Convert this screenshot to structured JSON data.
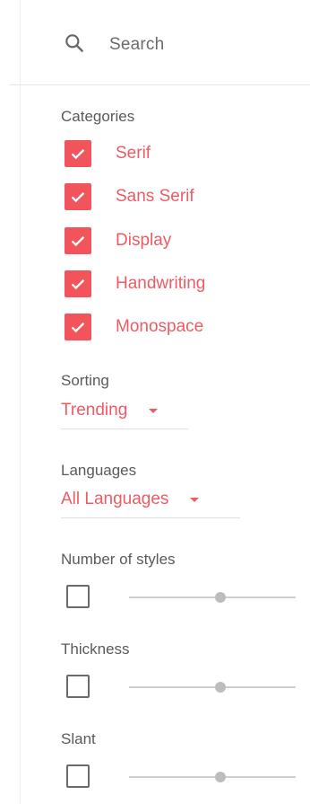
{
  "search": {
    "label": "Search"
  },
  "categories": {
    "heading": "Categories",
    "items": [
      {
        "label": "Serif",
        "checked": true
      },
      {
        "label": "Sans Serif",
        "checked": true
      },
      {
        "label": "Display",
        "checked": true
      },
      {
        "label": "Handwriting",
        "checked": true
      },
      {
        "label": "Monospace",
        "checked": true
      }
    ]
  },
  "sorting": {
    "heading": "Sorting",
    "value": "Trending"
  },
  "languages": {
    "heading": "Languages",
    "value": "All Languages"
  },
  "number_of_styles": {
    "heading": "Number of styles",
    "enabled": false,
    "slider_level": 0.55
  },
  "thickness": {
    "heading": "Thickness",
    "enabled": false,
    "slider_level": 0.55
  },
  "slant": {
    "heading": "Slant",
    "enabled": false,
    "slider_level": 0.55
  },
  "colors": {
    "accent": "#f2545b",
    "text": "#5a5a5a"
  }
}
